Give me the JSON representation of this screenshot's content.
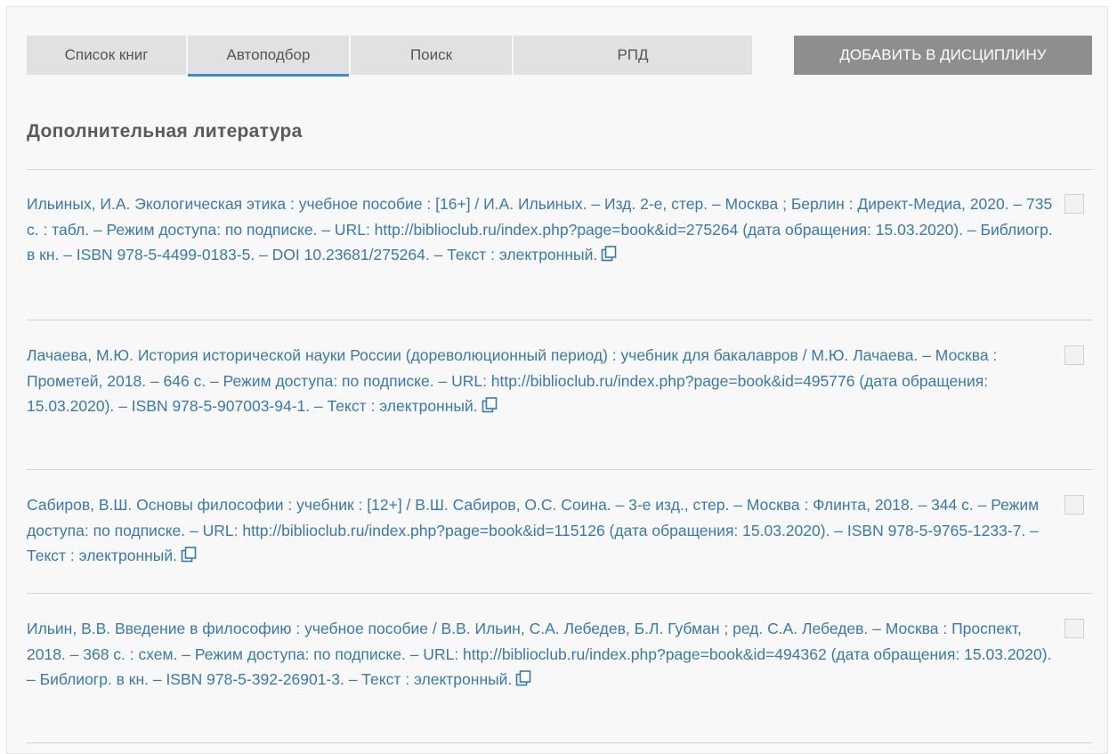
{
  "tabs": [
    {
      "label": "Список книг"
    },
    {
      "label": "Автоподбор"
    },
    {
      "label": "Поиск"
    },
    {
      "label": "РПД"
    }
  ],
  "active_tab": "Автоподбор",
  "add_button_label": "ДОБАВИТЬ В ДИСЦИПЛИНУ",
  "section_title": "Дополнительная литература",
  "entries": [
    {
      "text": "Ильиных, И.А. Экологическая этика : учебное пособие : [16+] / И.А. Ильиных. – Изд. 2-е, стер. – Москва ; Берлин : Директ-Медиа, 2020. – 735 с. : табл. – Режим доступа: по подписке. – URL: http://biblioclub.ru/index.php?page=book&id=275264 (дата обращения: 15.03.2020). – Библиогр. в кн. – ISBN 978-5-4499-0183-5. – DOI 10.23681/275264. – Текст : электронный."
    },
    {
      "text": "Лачаева, М.Ю. История исторической науки России (дореволюционный период) : учебник для бакалавров / М.Ю. Лачаева. – Москва : Прометей, 2018. – 646 с. – Режим доступа: по подписке. – URL: http://biblioclub.ru/index.php?page=book&id=495776 (дата обращения: 15.03.2020). – ISBN 978-5-907003-94-1. – Текст : электронный."
    },
    {
      "text": "Сабиров, В.Ш. Основы философии : учебник : [12+] / В.Ш. Сабиров, О.С. Соина. – 3-е изд., стер. – Москва : Флинта, 2018. – 344 с. – Режим доступа: по подписке. – URL: http://biblioclub.ru/index.php?page=book&id=115126 (дата обращения: 15.03.2020). – ISBN 978-5-9765-1233-7. – Текст : электронный."
    },
    {
      "text": "Ильин, В.В. Введение в философию : учебное пособие / В.В. Ильин, С.А. Лебедев, Б.Л. Губман ; ред. С.А. Лебедев. – Москва : Проспект, 2018. – 368 с. : схем. – Режим доступа: по подписке. – URL: http://biblioclub.ru/index.php?page=book&id=494362 (дата обращения: 15.03.2020). – Библиогр. в кн. – ISBN 978-5-392-26901-3. – Текст : электронный."
    }
  ],
  "colors": {
    "tab_bg": "#e1e1e1",
    "tab_active_underline": "#3c8ccd",
    "button_bg": "#8e8e8e",
    "link_text": "#3a79ad",
    "title_text": "#5a5a5a"
  }
}
